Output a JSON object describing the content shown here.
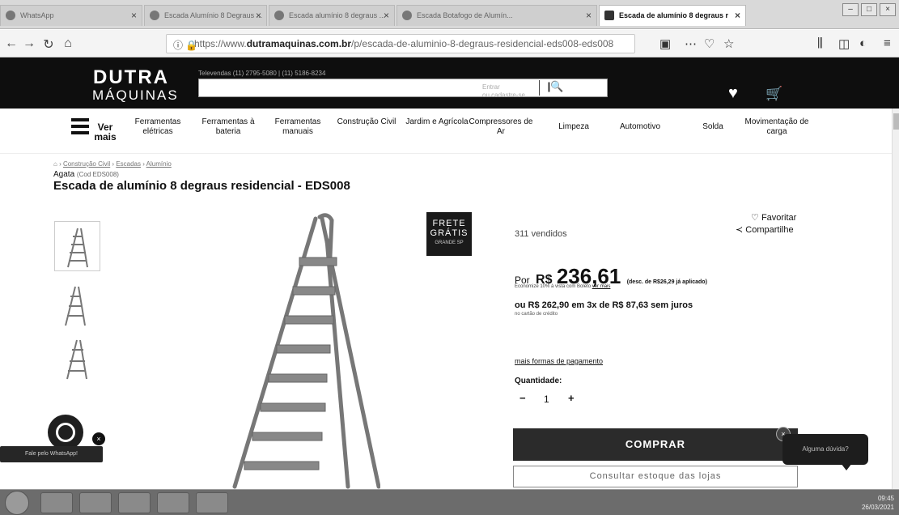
{
  "browser": {
    "tabs": [
      {
        "label": "WhatsApp",
        "active": false
      },
      {
        "label": "Escada Alumínio 8 Degraus ...",
        "active": false
      },
      {
        "label": "Escada alumínio 8 degraus ...",
        "active": false
      },
      {
        "label": "Escada Botafogo de Alumín...",
        "active": false
      },
      {
        "label": "Escada de alumínio 8 degraus r",
        "active": true
      }
    ],
    "url_prefix": "https://www.",
    "url_domain": "dutramaquinas.com.br",
    "url_path": "/p/escada-de-aluminio-8-degraus-residencial-eds008-eds008"
  },
  "site": {
    "logo_line1": "DUTRA",
    "logo_line2": "MÁQUINAS",
    "televendas": "Televendas (11) 2795-5080 | (11) 5186-8234",
    "login_line1": "Entrar",
    "login_line2": "ou cadastre-se"
  },
  "nav": {
    "ver_mais": "Ver mais",
    "categories": [
      "Ferramentas elétricas",
      "Ferramentas à bateria",
      "Ferramentas manuais",
      "Construção Civil",
      "Jardim e Agrícola",
      "Compressores de Ar",
      "Limpeza",
      "Automotivo",
      "Solda",
      "Movimentação de carga"
    ]
  },
  "product": {
    "breadcrumb": [
      "Construção Civil",
      "Escadas",
      "Alumínio"
    ],
    "brand": "Agata",
    "code": "(Cod EDS008)",
    "title": "Escada de alumínio 8 degraus residencial - EDS008",
    "frete_line1": "FRETE",
    "frete_line2": "GRÁTIS",
    "frete_line3": "GRANDE SP",
    "favoritar": "Favoritar",
    "compartilhe": "Compartilhe",
    "vendidos": "311 vendidos",
    "price_prefix": "Por",
    "currency": "R$",
    "price": "236,61",
    "discount_note": "(desc. de R$26,29 já aplicado)",
    "economize": "Economize 10% à vista com Boleto",
    "ver_mais_link": "ver mais",
    "installments": "ou R$ 262,90 em 3x de R$ 87,63 sem juros",
    "card_note": "no cartão de crédito",
    "mais_formas": "mais formas de pagamento",
    "quantidade_label": "Quantidade:",
    "quantity": "1",
    "comprar": "COMPRAR",
    "consultar": "Consultar estoque das lojas"
  },
  "widgets": {
    "chat_prompt": "Alguma dúvida?",
    "whatsapp_label": "Fale pelo WhatsApp!"
  },
  "taskbar": {
    "time": "09:45",
    "date": "26/03/2021"
  }
}
